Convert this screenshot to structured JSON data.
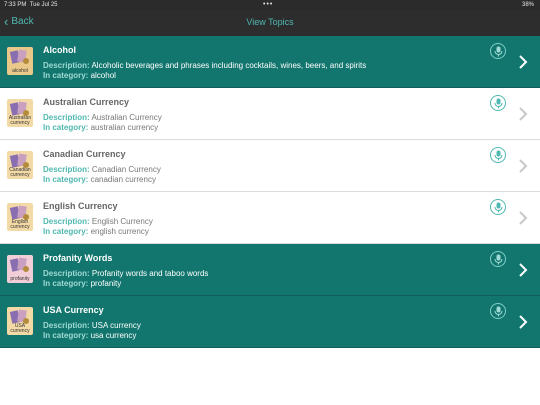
{
  "status": {
    "time": "7:33 PM",
    "date": "Tue Jul 25",
    "dots": "•••",
    "battery": "38%"
  },
  "nav": {
    "back_label": "Back",
    "title": "View Topics"
  },
  "labels": {
    "description": "Description:",
    "category": "In category:"
  },
  "colors": {
    "teal": "#12766e",
    "accent": "#4fb8b0"
  },
  "topics": [
    {
      "title": "Alcohol",
      "description": "Alcoholic beverages and phrases including cocktails, wines, beers, and spirits",
      "category": "alcohol",
      "thumb_label": "alcohol",
      "highlighted": true,
      "thumb_color": "#e9c88a"
    },
    {
      "title": "Australian Currency",
      "description": "Australian Currency",
      "category": "australian currency",
      "thumb_label": "Australian currency",
      "highlighted": false,
      "thumb_color": "#f3d9a6"
    },
    {
      "title": "Canadian Currency",
      "description": "Canadian Currency",
      "category": "canadian currency",
      "thumb_label": "Canadian currency",
      "highlighted": false,
      "thumb_color": "#f3d9a6"
    },
    {
      "title": "English Currency",
      "description": "English Currency",
      "category": "english currency",
      "thumb_label": "English currency",
      "highlighted": false,
      "thumb_color": "#f3d9a6"
    },
    {
      "title": "Profanity Words",
      "description": "Profanity words and taboo words",
      "category": "profanity",
      "thumb_label": "profanity",
      "highlighted": true,
      "thumb_color": "#f2cfd8"
    },
    {
      "title": "USA Currency",
      "description": "USA currency",
      "category": "usa currency",
      "thumb_label": "USA currency",
      "highlighted": true,
      "thumb_color": "#f3d9a6"
    }
  ]
}
